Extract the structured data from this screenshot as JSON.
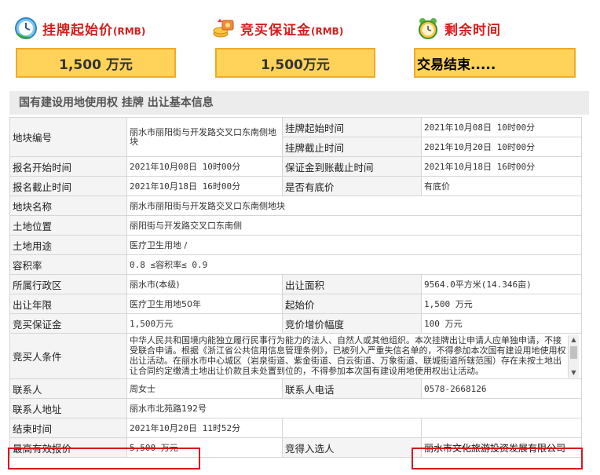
{
  "header": {
    "start_price": {
      "label": "挂牌起始价",
      "unit": "(RMB)",
      "value": "1,500 万元",
      "icon": "clock-icon"
    },
    "deposit": {
      "label": "竞买保证金",
      "unit": "(RMB)",
      "value": "1,500万元",
      "icon": "money-coins-icon"
    },
    "remaining": {
      "label": "剩余时间",
      "value": "交易结束.....",
      "icon": "alarm-clock-icon"
    }
  },
  "subtitle": "国有建设用地使用权 挂牌 出让基本信息",
  "rows": {
    "parcel_no": {
      "key": "地块编号",
      "value": "丽水市丽阳街与开发路交叉口东南侧地块"
    },
    "listing_start": {
      "key": "挂牌起始时间",
      "value": "2021年10月08日 10时00分"
    },
    "listing_end": {
      "key": "挂牌截止时间",
      "value": "2021年10月20日 10时00分"
    },
    "reg_start": {
      "key": "报名开始时间",
      "value": "2021年10月08日 10时00分"
    },
    "deposit_deadline": {
      "key": "保证金到账截止时间",
      "value": "2021年10月18日 16时00分"
    },
    "reg_end": {
      "key": "报名截止时间",
      "value": "2021年10月18日 16时00分"
    },
    "reserve": {
      "key": "是否有底价",
      "value": "有底价"
    },
    "parcel_name": {
      "key": "地块名称",
      "value": "丽水市丽阳街与开发路交叉口东南侧地块"
    },
    "location": {
      "key": "土地位置",
      "value": "丽阳街与开发路交叉口东南侧"
    },
    "usage": {
      "key": "土地用途",
      "value": "医疗卫生用地 /"
    },
    "far": {
      "key": "容积率",
      "value": "0.8 ≤容积率≤ 0.9"
    },
    "district": {
      "key": "所属行政区",
      "value": "丽水市(本级)"
    },
    "area": {
      "key": "出让面积",
      "value": "9564.0平方米(14.346亩)"
    },
    "term": {
      "key": "出让年限",
      "value": "医疗卫生用地50年"
    },
    "start_price": {
      "key": "起始价",
      "value": "1,500 万元"
    },
    "bid_deposit": {
      "key": "竞买保证金",
      "value": "1,500万元"
    },
    "increment": {
      "key": "竞价增价幅度",
      "value": "100 万元"
    },
    "conditions": {
      "key": "竞买人条件",
      "value": "中华人民共和国境内能独立履行民事行为能力的法人、自然人或其他组织。本次挂牌出让申请人应单独申请，不接受联合申请。根据《浙江省公共信用信息管理条例》，已被列入严重失信名单的，不得参加本次国有建设用地使用权出让活动。在丽水市中心城区（岩泉街道、紫金街道、白云街道、万象街道、联城街道所辖范围）存在未按土地出让合同约定缴清土地出让价款且未处置到位的，不得参加本次国有建设用地使用权出让活动。"
    },
    "contact": {
      "key": "联系人",
      "value": "周女士"
    },
    "phone": {
      "key": "联系人电话",
      "value": "0578-2668126"
    },
    "address": {
      "key": "联系人地址",
      "value": "丽水市北苑路192号"
    },
    "end_time": {
      "key": "结束时间",
      "value": "2021年10月20日 11时52分"
    },
    "highest_bid": {
      "key": "最高有效报价",
      "value": "5,500 万元"
    },
    "winner": {
      "key": "竞得入选人",
      "value": "丽水市文化旅游投资发展有限公司"
    }
  },
  "colors": {
    "accent_red": "#d2201e",
    "box_fill": "#ffd35a",
    "box_border": "#f0a92a",
    "highlight": "#d8171f"
  }
}
